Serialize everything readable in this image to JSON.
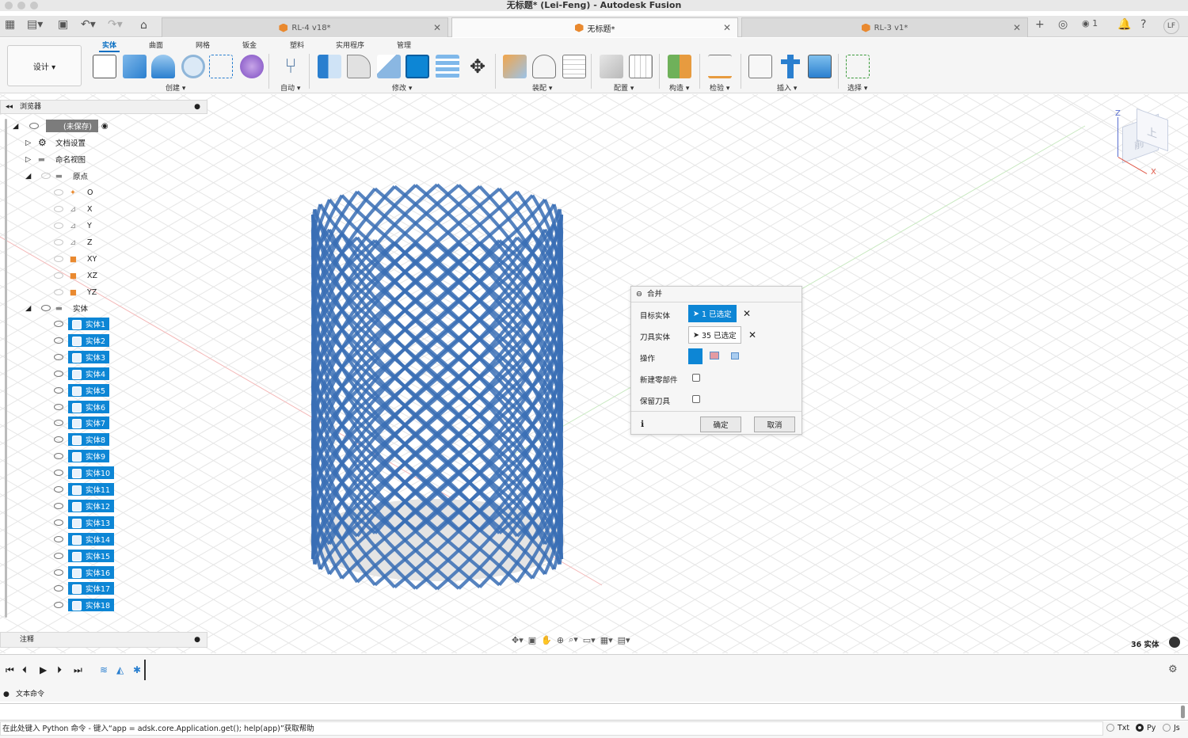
{
  "window": {
    "title": "无标题* (Lei-Feng) - Autodesk Fusion"
  },
  "tabs": [
    {
      "label": "RL-4 v18*"
    },
    {
      "label": "无标题*"
    },
    {
      "label": "RL-3 v1*"
    }
  ],
  "topbar": {
    "jobs_count": "1",
    "user_initials": "LF"
  },
  "ribbon": {
    "workspace_label": "设计 ▾",
    "tabs": [
      "实体",
      "曲面",
      "网格",
      "钣金",
      "塑料",
      "实用程序",
      "管理"
    ],
    "groups": [
      "创建 ▾",
      "自动 ▾",
      "修改 ▾",
      "装配 ▾",
      "配置 ▾",
      "构造 ▾",
      "检验 ▾",
      "插入 ▾",
      "选择 ▾"
    ]
  },
  "browser": {
    "title": "浏览器",
    "root_label": "(未保存)",
    "items": [
      "文档设置",
      "命名视图",
      "原点"
    ],
    "origin_items": [
      "O",
      "X",
      "Y",
      "Z",
      "XY",
      "XZ",
      "YZ"
    ],
    "bodies_folder": "实体",
    "bodies": [
      "实体1",
      "实体2",
      "实体3",
      "实体4",
      "实体5",
      "实体6",
      "实体7",
      "实体8",
      "实体9",
      "实体10",
      "实体11",
      "实体12",
      "实体13",
      "实体14",
      "实体15",
      "实体16",
      "实体17",
      "实体18"
    ],
    "notes_label": "注释"
  },
  "viewcube": {
    "labels": {
      "z": "Z",
      "x": "X",
      "front": "前",
      "top": "上"
    }
  },
  "combine_dialog": {
    "title": "合并",
    "target_label": "目标实体",
    "target_value": "1 已选定",
    "tool_label": "刀具实体",
    "tool_value": "35 已选定",
    "operation_label": "操作",
    "new_component_label": "新建零部件",
    "keep_tools_label": "保留刀具",
    "ok_label": "确定",
    "cancel_label": "取消"
  },
  "status": {
    "bodies_count": "36 实体"
  },
  "text_commands": {
    "header": "文本命令",
    "prompt": "在此处键入 Python 命令 - 键入“app = adsk.core.Application.get(); help(app)”获取帮助",
    "modes": [
      "Txt",
      "Py",
      "Js"
    ],
    "selected_mode": "Py"
  },
  "colors": {
    "accent": "#0d86d5",
    "mesh": "#3a6fb5",
    "tab_cube": "#e9892f"
  }
}
